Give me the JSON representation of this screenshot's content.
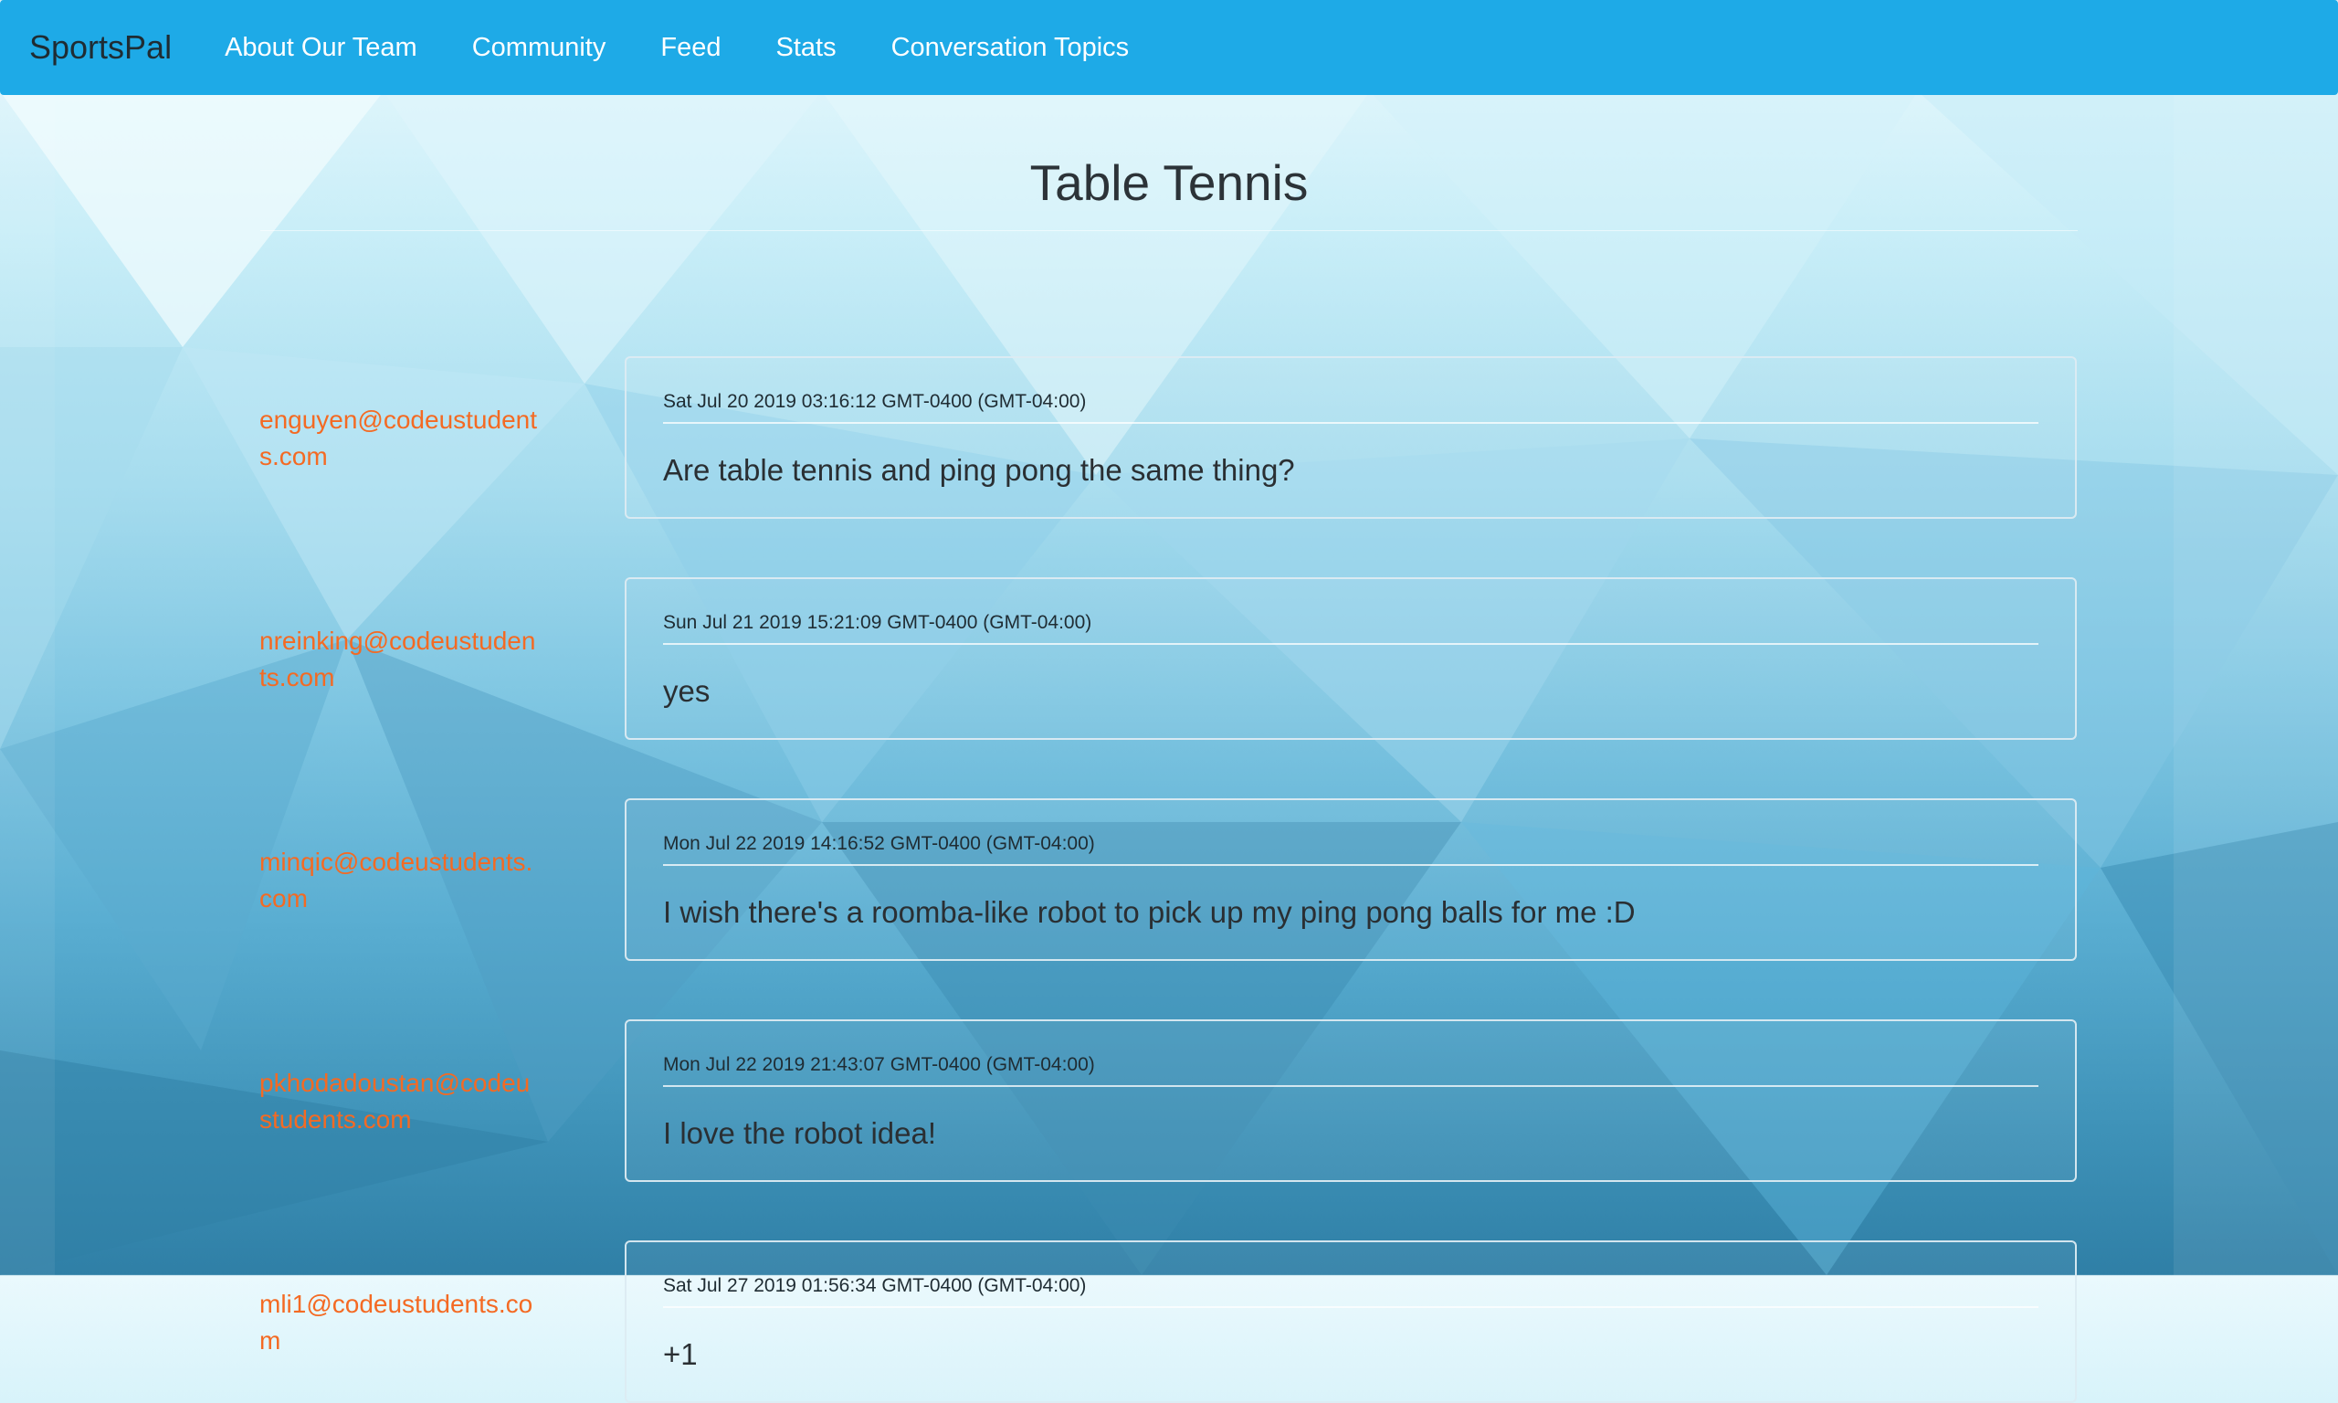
{
  "nav": {
    "brand": "SportsPal",
    "links": [
      "About Our Team",
      "Community",
      "Feed",
      "Stats",
      "Conversation Topics"
    ]
  },
  "page": {
    "title": "Table Tennis"
  },
  "messages": [
    {
      "author": "enguyen@codeustudents.com",
      "timestamp": "Sat Jul 20 2019 03:16:12 GMT-0400 (GMT-04:00)",
      "text": "Are table tennis and ping pong the same thing?"
    },
    {
      "author": "nreinking@codeustudents.com",
      "timestamp": "Sun Jul 21 2019 15:21:09 GMT-0400 (GMT-04:00)",
      "text": "yes"
    },
    {
      "author": "minqic@codeustudents.com",
      "timestamp": "Mon Jul 22 2019 14:16:52 GMT-0400 (GMT-04:00)",
      "text": "I wish there's a roomba-like robot to pick up my ping pong balls for me :D"
    },
    {
      "author": "pkhodadoustan@codeustudents.com",
      "timestamp": "Mon Jul 22 2019 21:43:07 GMT-0400 (GMT-04:00)",
      "text": "I love the robot idea!"
    },
    {
      "author": "mli1@codeustudents.com",
      "timestamp": "Sat Jul 27 2019 01:56:34 GMT-0400 (GMT-04:00)",
      "text": "+1"
    }
  ],
  "colors": {
    "navbar": "#1eaae7",
    "author_link": "#f46a23"
  }
}
